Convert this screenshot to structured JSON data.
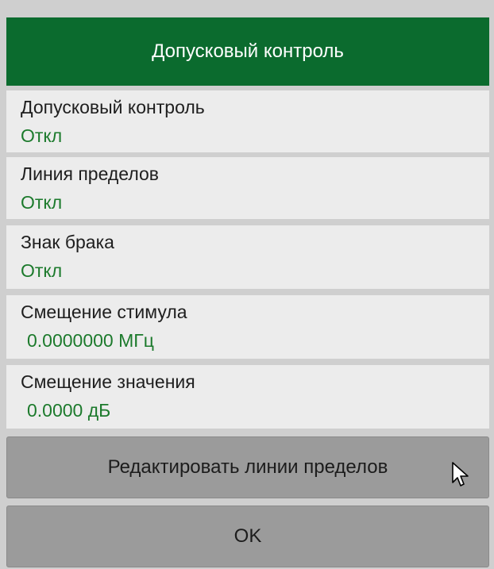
{
  "dialog": {
    "title": "Допусковый контроль",
    "items": [
      {
        "label": "Допусковый контроль",
        "value": "Откл"
      },
      {
        "label": "Линия пределов",
        "value": "Откл"
      },
      {
        "label": "Знак брака",
        "value": "Откл"
      },
      {
        "label": "Смещение стимула",
        "value": "0.0000000 МГц"
      },
      {
        "label": "Смещение значения",
        "value": "0.0000 дБ"
      }
    ],
    "buttons": {
      "edit_limits": "Редактировать линии пределов",
      "ok": "OK"
    }
  },
  "colors": {
    "header_bg": "#0b6b2e",
    "value_text": "#1c7a2c",
    "item_bg": "#ececec",
    "button_bg": "#9b9b9b"
  },
  "icons": {
    "pointer": "mouse-pointer-icon"
  }
}
